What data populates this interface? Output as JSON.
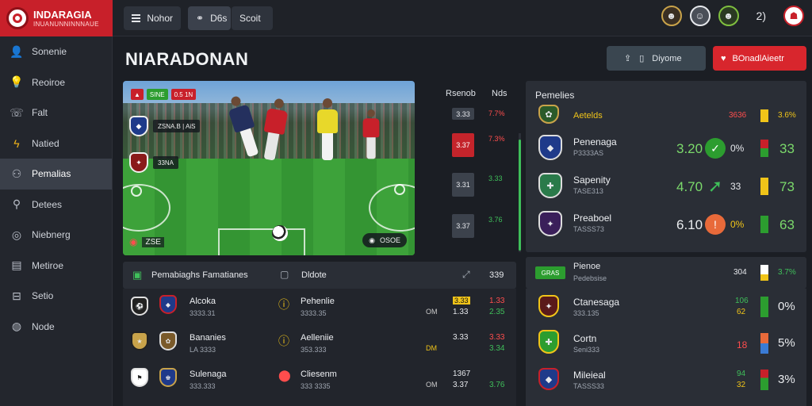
{
  "brand": {
    "name": "INDARAGIA",
    "tagline": "INUANUNNINNNAUE"
  },
  "topbar": {
    "menu_label": "Nohor",
    "tab1_label": "D6s",
    "tab2_label": "Scoit",
    "count": "2)"
  },
  "sidebar": {
    "items": [
      {
        "label": "Sonenie",
        "icon": "person-icon",
        "active": false
      },
      {
        "label": "Reoiroe",
        "icon": "lightbulb-icon",
        "active": false
      },
      {
        "label": "Falt",
        "icon": "phone-icon",
        "active": false
      },
      {
        "label": "Natied",
        "icon": "bolt-icon",
        "active": false
      },
      {
        "label": "Pemalias",
        "icon": "users-icon",
        "active": true
      },
      {
        "label": "Detees",
        "icon": "pin-icon",
        "active": false
      },
      {
        "label": "Niebnerg",
        "icon": "target-icon",
        "active": false
      },
      {
        "label": "Metiroe",
        "icon": "clipboard-icon",
        "active": false
      },
      {
        "label": "Setio",
        "icon": "lock-icon",
        "active": false
      },
      {
        "label": "Node",
        "icon": "globe-icon",
        "active": false
      }
    ]
  },
  "page": {
    "title": "NIARADONAN",
    "share_label": "Diyome",
    "cta_label": "BOnadlAieetr"
  },
  "video": {
    "hud_top": [
      "SINE",
      "0.5 1N"
    ],
    "hud_rows": [
      {
        "text": "ZSNA.B | AiS"
      },
      {
        "text": "33NA"
      }
    ],
    "hud_bottom": "ZSE",
    "hud_right": "OSOE"
  },
  "market": {
    "col1": "Rsenob",
    "col2": "Nds",
    "rows": [
      {
        "a": "3.33",
        "b": "7.7%",
        "red": false
      },
      {
        "a": "3.37",
        "b": "7.3%",
        "red": true
      },
      {
        "a": "3.31",
        "b": "3.33",
        "red": false
      },
      {
        "a": "3.37",
        "b": "3.76",
        "red": false
      }
    ]
  },
  "right_panel": {
    "title": "Pemelies",
    "rows": [
      {
        "name": "Aetelds",
        "sub": "",
        "num": "",
        "pct": "3636",
        "odd": "3.6%",
        "name_color": "#f0c419",
        "bar": "#f0c419"
      },
      {
        "name": "Penenaga",
        "sub": "P3333AS",
        "num": "3.20",
        "pct": "0%",
        "odd": "33",
        "bar": "#2c9d2f"
      },
      {
        "name": "Sapenity",
        "sub": "TASE313",
        "num": "4.70",
        "pct": "33",
        "odd": "73",
        "bar": "#f0c419"
      },
      {
        "name": "Preaboel",
        "sub": "TASSS73",
        "num": "6.10",
        "pct": "0%",
        "odd": "63",
        "bar": "#2c9d2f"
      }
    ]
  },
  "lower_left": {
    "title": "Pemabiaghs Famatianes",
    "col2": "Dldote",
    "count": "339",
    "rows": [
      {
        "home": "Alcoka",
        "home_sub": "3333.31",
        "away": "Pehenlie",
        "away_sub": "3333.35",
        "tag": "OM",
        "odd1": "3.33",
        "odd2": "1.33",
        "odd3": "2.35"
      },
      {
        "home": "Bananies",
        "home_sub": "LA 3333",
        "away": "Aelleniie",
        "away_sub": "353.333",
        "tag": "DM",
        "odd1": "3.33",
        "odd2": "3.33",
        "odd3": "3.34"
      },
      {
        "home": "Sulenaga",
        "home_sub": "333.333",
        "away": "Cliesenm",
        "away_sub": "333 3335",
        "tag": "OM",
        "odd1": "3.37",
        "odd2": "1367",
        "odd3": "3.76"
      }
    ]
  },
  "lower_right": {
    "title": "Pienoe",
    "sub": "Pedebsise",
    "pill": "GRAS",
    "num": "304",
    "pct": "3.7%",
    "rows": [
      {
        "name": "Ctanesaga",
        "sub": "333.135",
        "a": "106",
        "b": "62",
        "pct": "0%",
        "bar": "#2c9d2f"
      },
      {
        "name": "Cortn",
        "sub": "Seni333",
        "a": "18",
        "b": "",
        "pct": "5%",
        "bar": "#e86a3a"
      },
      {
        "name": "Mileieal",
        "sub": "TASSS33",
        "a": "94",
        "b": "32",
        "pct": "3%",
        "bar": "#2c9d2f"
      }
    ]
  }
}
